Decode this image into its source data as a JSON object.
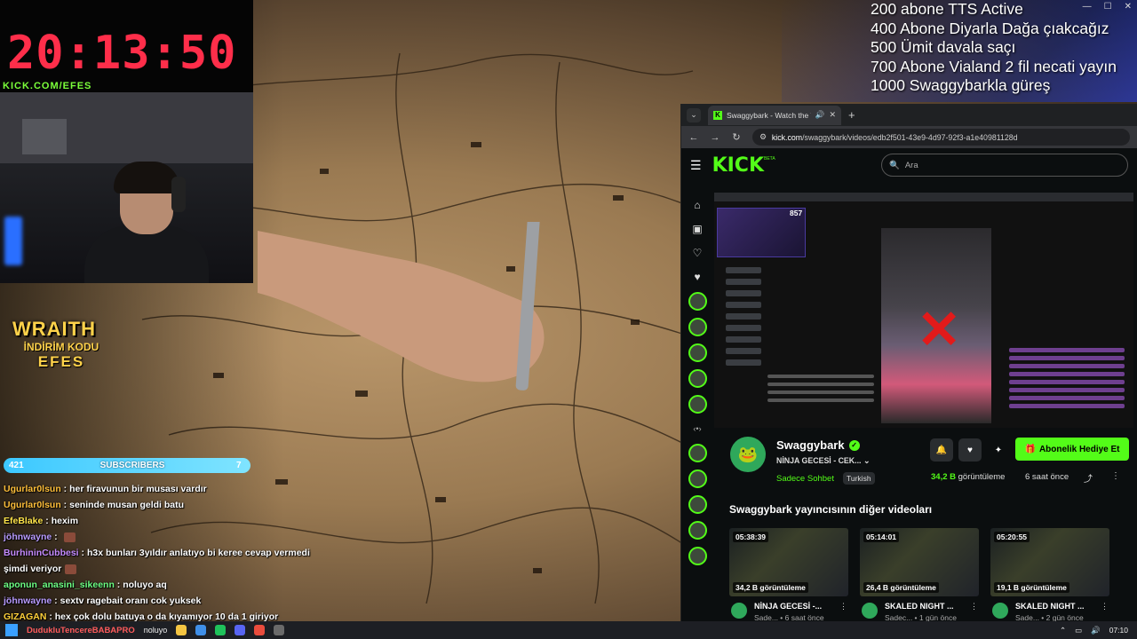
{
  "overlay": {
    "timer": "20:13:50",
    "kick_handle": "KICK.COM/EFES",
    "sponsor": {
      "brand": "WRAITH",
      "line1": "İNDİRİM KODU",
      "code": "EFES"
    },
    "subs": {
      "left_count": "421",
      "label": "SUBSCRIBERS",
      "right_count": "7",
      "color": "#3cc8ff"
    },
    "goals": [
      "200 abone TTS Active",
      "400 Abone Diyarla Dağa çıakcağız",
      "500 Ümit davala saçı",
      "700 Abone Vialand 2 fil necati yayın",
      "1000 Swaggybarkla güreş"
    ]
  },
  "chat": [
    {
      "user": "Ugurlar0lsun",
      "color": "#ffbf3a",
      "msg": "her firavunun bir musası vardır"
    },
    {
      "user": "Ugurlar0lsun",
      "color": "#ffbf3a",
      "msg": "seninde musan geldi batu"
    },
    {
      "user": "EfeBlake",
      "color": "#ffe44a",
      "msg": "hexim"
    },
    {
      "user": "jöhnwayne",
      "color": "#b89bff",
      "msg": ""
    },
    {
      "user": "BurhininCubbesi",
      "color": "#c58bff",
      "msg": "h3x bunları 3yıldır anlatıyo bi keree cevap vermedi"
    },
    {
      "user": "",
      "color": "#ffffff",
      "msg": "şimdi veriyor"
    },
    {
      "user": "aponun_anasini_sikeenn",
      "color": "#6dff84",
      "msg": "noluyo aq"
    },
    {
      "user": "jöhnwayne",
      "color": "#b89bff",
      "msg": "sextv ragebait oranı cok yuksek"
    },
    {
      "user": "GIZAGAN",
      "color": "#ffd03a",
      "msg": "hex çok dolu batuya o da kıyamıyor 10 da 1 giriyor"
    }
  ],
  "browser": {
    "tab_title": "Swaggybark - Watch the VOD",
    "url_host": "kick.com",
    "url_path": "/swaggybark/videos/edb2f501-43e9-4d97-92f3-a1e40981128d",
    "search_placeholder": "Ara",
    "logo": "KICK",
    "logo_badge": "BETA",
    "video_viewers": "857",
    "channel": {
      "name": "Swaggybark",
      "title": "NİNJA GECESİ - CEK...",
      "category": "Sadece Sohbet",
      "language": "Turkish",
      "views_value": "34,2 B",
      "views_suffix": "görüntüleme",
      "ago": "6 saat önce",
      "gift_label": "Abonelik Hediye Et"
    },
    "other_videos_title": "Swaggybark yayıncısının diğer videoları",
    "videos": [
      {
        "duration": "05:38:39",
        "views": "34,2 B görüntüleme",
        "title": "NİNJA GECESİ -...",
        "sub": "Sade...",
        "ago": "6 saat önce"
      },
      {
        "duration": "05:14:01",
        "views": "26,4 B görüntüleme",
        "title": "SKALED NIGHT ...",
        "sub": "Sadec...",
        "ago": "1 gün önce"
      },
      {
        "duration": "05:20:55",
        "views": "19,1 B görüntüleme",
        "title": "SKALED NIGHT ...",
        "sub": "Sade...",
        "ago": "2 gün önce"
      }
    ]
  },
  "taskbar": {
    "search_text": "DudukluTencereBABAPRO",
    "search_suffix": "noluyo",
    "time": "07:10"
  }
}
